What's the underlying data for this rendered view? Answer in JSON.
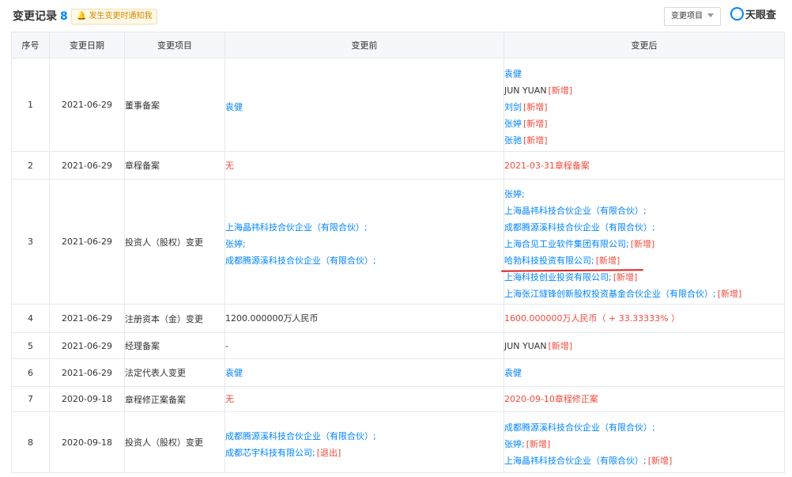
{
  "header": {
    "title": "变更记录",
    "count": "8",
    "notify": "发生变更时通知我",
    "filter": "变更项目",
    "logo": "天眼查"
  },
  "columns": [
    "序号",
    "变更日期",
    "变更项目",
    "变更前",
    "变更后"
  ],
  "rows": [
    {
      "no": "1",
      "date": "2021-06-29",
      "item": "董事备案",
      "before": [
        {
          "text": "袁健",
          "color": "blue"
        }
      ],
      "after": [
        {
          "text": "袁健",
          "color": "blue"
        },
        {
          "text": "JUN YUAN",
          "color": "dark",
          "tag": "[新增]"
        },
        {
          "text": "刘剑",
          "color": "blue",
          "tag": "[新增]"
        },
        {
          "text": "张婷",
          "color": "blue",
          "tag": "[新增]"
        },
        {
          "text": "张驰",
          "color": "blue",
          "tag": "[新增]"
        }
      ]
    },
    {
      "no": "2",
      "date": "2021-06-29",
      "item": "章程备案",
      "before": [
        {
          "text": "无",
          "color": "red"
        }
      ],
      "after": [
        {
          "text": "2021-03-31章程备案",
          "color": "red"
        }
      ]
    },
    {
      "no": "3",
      "date": "2021-06-29",
      "item": "投资人（股权）变更",
      "before": [
        {
          "text": "上海晶祎科技合伙企业（有限合伙）;",
          "color": "blue"
        },
        {
          "text": "张婷;",
          "color": "blue"
        },
        {
          "text": "成都腾源溪科技合伙企业（有限合伙）;",
          "color": "blue"
        }
      ],
      "after": [
        {
          "text": "张婷;",
          "color": "blue"
        },
        {
          "text": "上海晶祎科技合伙企业（有限合伙）;",
          "color": "blue"
        },
        {
          "text": "成都腾源溪科技合伙企业（有限合伙）;",
          "color": "blue"
        },
        {
          "text": "上海合见工业软件集团有限公司;",
          "color": "blue",
          "tag": "[新增]"
        },
        {
          "text": "哈勃科技投资有限公司;",
          "color": "blue",
          "tag": "[新增]",
          "underline": true
        },
        {
          "text": "上海科技创业投资有限公司;",
          "color": "blue",
          "tag": "[新增]"
        },
        {
          "text": "上海张江燧锋创新股权投资基金合伙企业（有限合伙）;",
          "color": "blue",
          "tag": "[新增]"
        }
      ]
    },
    {
      "no": "4",
      "date": "2021-06-29",
      "item": "注册资本（金）变更",
      "before": [
        {
          "text": "1200.000000万人民币",
          "color": "dark"
        }
      ],
      "after": [
        {
          "text": "1600.000000万人民币（ + 33.33333% ）",
          "color": "red"
        }
      ]
    },
    {
      "no": "5",
      "date": "2021-06-29",
      "item": "经理备案",
      "before": [
        {
          "text": "-",
          "color": "dark"
        }
      ],
      "after": [
        {
          "text": "JUN YUAN",
          "color": "dark",
          "tag": "[新增]"
        }
      ]
    },
    {
      "no": "6",
      "date": "2021-06-29",
      "item": "法定代表人变更",
      "before": [
        {
          "text": "袁健",
          "color": "blue"
        }
      ],
      "after": [
        {
          "text": "袁健",
          "color": "blue"
        }
      ]
    },
    {
      "no": "7",
      "date": "2020-09-18",
      "item": "章程修正案备案",
      "before": [
        {
          "text": "无",
          "color": "red"
        }
      ],
      "after": [
        {
          "text": "2020-09-10章程修正案",
          "color": "red"
        }
      ]
    },
    {
      "no": "8",
      "date": "2020-09-18",
      "item": "投资人（股权）变更",
      "before": [
        {
          "text": "成都腾源溪科技合伙企业（有限合伙）;",
          "color": "blue"
        },
        {
          "text": "成都芯宇科技有限公司;",
          "color": "blue",
          "tag": "[退出]"
        }
      ],
      "after": [
        {
          "text": "成都腾源溪科技合伙企业（有限合伙）;",
          "color": "blue"
        },
        {
          "text": "张婷;",
          "color": "blue",
          "tag": "[新增]"
        },
        {
          "text": "上海晶祎科技合伙企业（有限合伙）;",
          "color": "blue",
          "tag": "[新增]"
        }
      ]
    }
  ],
  "colors": {
    "link": "#0084ff",
    "accent_red": "#f04b3c",
    "header_bg": "#f5f7fa",
    "border": "#e4e8ef"
  }
}
